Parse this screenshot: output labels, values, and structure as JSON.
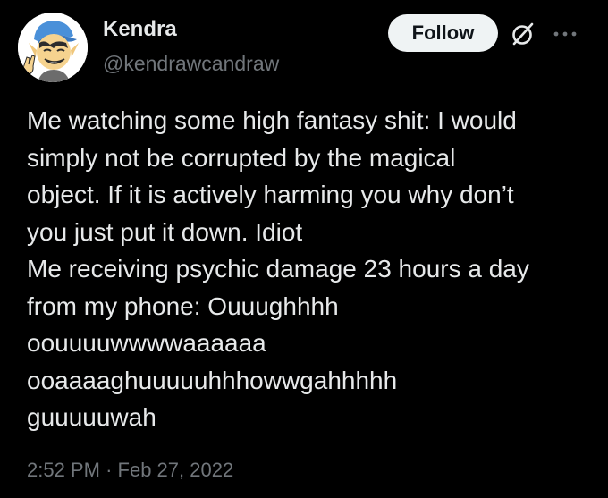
{
  "author": {
    "display_name": "Kendra",
    "handle": "@kendrawcandraw",
    "avatar_icon": "cartoon-avatar"
  },
  "header": {
    "follow_label": "Follow",
    "grok_icon": "grok-icon",
    "more_icon": "more-options-icon"
  },
  "tweet": {
    "lines": [
      "Me watching some high fantasy shit: I would",
      "simply not be corrupted by the magical",
      "object. If it is actively harming you why don’t",
      "you just put it down. Idiot",
      "Me receiving psychic damage 23 hours a day",
      "from my phone: Ouuughhhh",
      "oouuuuwwwwaaaaaa",
      "ooaaaaghuuuuuhhhowwgahhhhh",
      "guuuuuwah"
    ]
  },
  "meta": {
    "time": "2:52 PM",
    "separator": "·",
    "date": "Feb 27, 2022"
  },
  "colors": {
    "background": "#000000",
    "text": "#e7e9ea",
    "secondary_text": "#71767b",
    "follow_bg": "#eff3f4"
  }
}
